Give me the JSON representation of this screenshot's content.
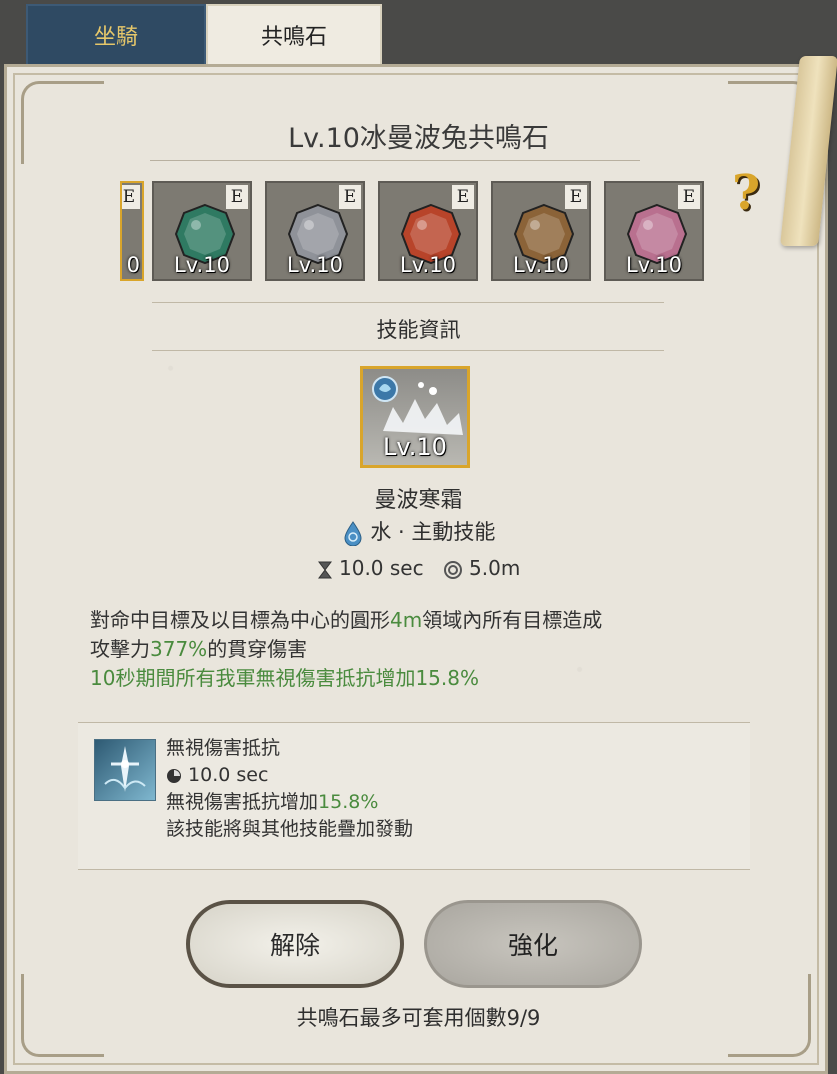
{
  "tabs": {
    "mount": "坐騎",
    "stone": "共鳴石"
  },
  "title": "Lv.10冰曼波兔共鳴石",
  "help_icon": "question-mark-icon",
  "stones": [
    {
      "grade": "E",
      "level": "Lv.10",
      "color": "#2f7a62"
    },
    {
      "grade": "E",
      "level": "Lv.10",
      "color": "#8f9299"
    },
    {
      "grade": "E",
      "level": "Lv.10",
      "color": "#b8442a"
    },
    {
      "grade": "E",
      "level": "Lv.10",
      "color": "#8b6338"
    },
    {
      "grade": "E",
      "level": "Lv.10",
      "color": "#b9708f"
    }
  ],
  "partial_stone": {
    "grade": "E",
    "level": "0"
  },
  "section_label": "技能資訊",
  "skill": {
    "level": "Lv.10",
    "name": "曼波寒霜",
    "type": "水 · 主動技能",
    "cooldown": "10.0 sec",
    "range": "5.0m"
  },
  "description": {
    "line1_a": "對命中目標及以目標為中心的圓形",
    "line1_b": "4m",
    "line1_c": "領域內所有目標造成",
    "line2_a": "攻擊力",
    "line2_b": "377%",
    "line2_c": "的貫穿傷害",
    "line3_a": "10",
    "line3_b": "秒期間所有我軍無視傷害抵抗增加",
    "line3_c": "15.8%"
  },
  "buff": {
    "name": "無視傷害抵抗",
    "duration": "10.0 sec",
    "effect_a": "無視傷害抵抗增加",
    "effect_b": "15.8%",
    "note": "該技能將與其他技能疊加發動"
  },
  "buttons": {
    "release": "解除",
    "upgrade": "強化"
  },
  "footer": "共鳴石最多可套用個數9/9",
  "colors": {
    "highlight_green": "#4a8b3e",
    "gold_border": "#d9a52b",
    "tab_blue": "#2f4a63"
  }
}
